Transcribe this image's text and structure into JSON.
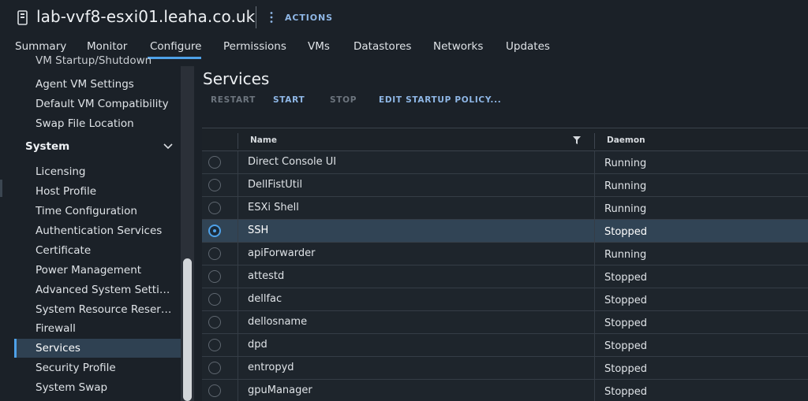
{
  "header": {
    "title": "lab-vvf8-esxi01.leaha.co.uk",
    "actions_label": "ACTIONS"
  },
  "tabs": [
    {
      "label": "Summary"
    },
    {
      "label": "Monitor"
    },
    {
      "label": "Configure",
      "active": true
    },
    {
      "label": "Permissions"
    },
    {
      "label": "VMs"
    },
    {
      "label": "Datastores"
    },
    {
      "label": "Networks"
    },
    {
      "label": "Updates"
    }
  ],
  "sidebar": {
    "items_top": [
      {
        "label": "VM Startup/Shutdown"
      },
      {
        "label": "Agent VM Settings"
      },
      {
        "label": "Default VM Compatibility"
      },
      {
        "label": "Swap File Location"
      }
    ],
    "group_label": "System",
    "items_system": [
      {
        "label": "Licensing"
      },
      {
        "label": "Host Profile"
      },
      {
        "label": "Time Configuration"
      },
      {
        "label": "Authentication Services"
      },
      {
        "label": "Certificate"
      },
      {
        "label": "Power Management"
      },
      {
        "label": "Advanced System Settin..."
      },
      {
        "label": "System Resource Reserv..."
      },
      {
        "label": "Firewall"
      },
      {
        "label": "Services",
        "selected": true
      },
      {
        "label": "Security Profile"
      },
      {
        "label": "System Swap"
      }
    ]
  },
  "main": {
    "title": "Services",
    "toolbar": {
      "restart": "RESTART",
      "start": "START",
      "stop": "STOP",
      "edit_policy": "EDIT STARTUP POLICY..."
    },
    "grid": {
      "columns": {
        "name": "Name",
        "daemon": "Daemon"
      },
      "rows": [
        {
          "name": "Direct Console UI",
          "daemon": "Running"
        },
        {
          "name": "DellFistUtil",
          "daemon": "Running"
        },
        {
          "name": "ESXi Shell",
          "daemon": "Running"
        },
        {
          "name": "SSH",
          "daemon": "Stopped",
          "selected": true
        },
        {
          "name": "apiForwarder",
          "daemon": "Running"
        },
        {
          "name": "attestd",
          "daemon": "Stopped"
        },
        {
          "name": "dellfac",
          "daemon": "Stopped"
        },
        {
          "name": "dellosname",
          "daemon": "Stopped"
        },
        {
          "name": "dpd",
          "daemon": "Stopped"
        },
        {
          "name": "entropyd",
          "daemon": "Stopped"
        },
        {
          "name": "gpuManager",
          "daemon": "Stopped"
        }
      ]
    }
  },
  "colors": {
    "accent": "#4ea1e8",
    "link": "#8fb7e6",
    "background": "#1b2128",
    "selected_row": "#314455"
  }
}
